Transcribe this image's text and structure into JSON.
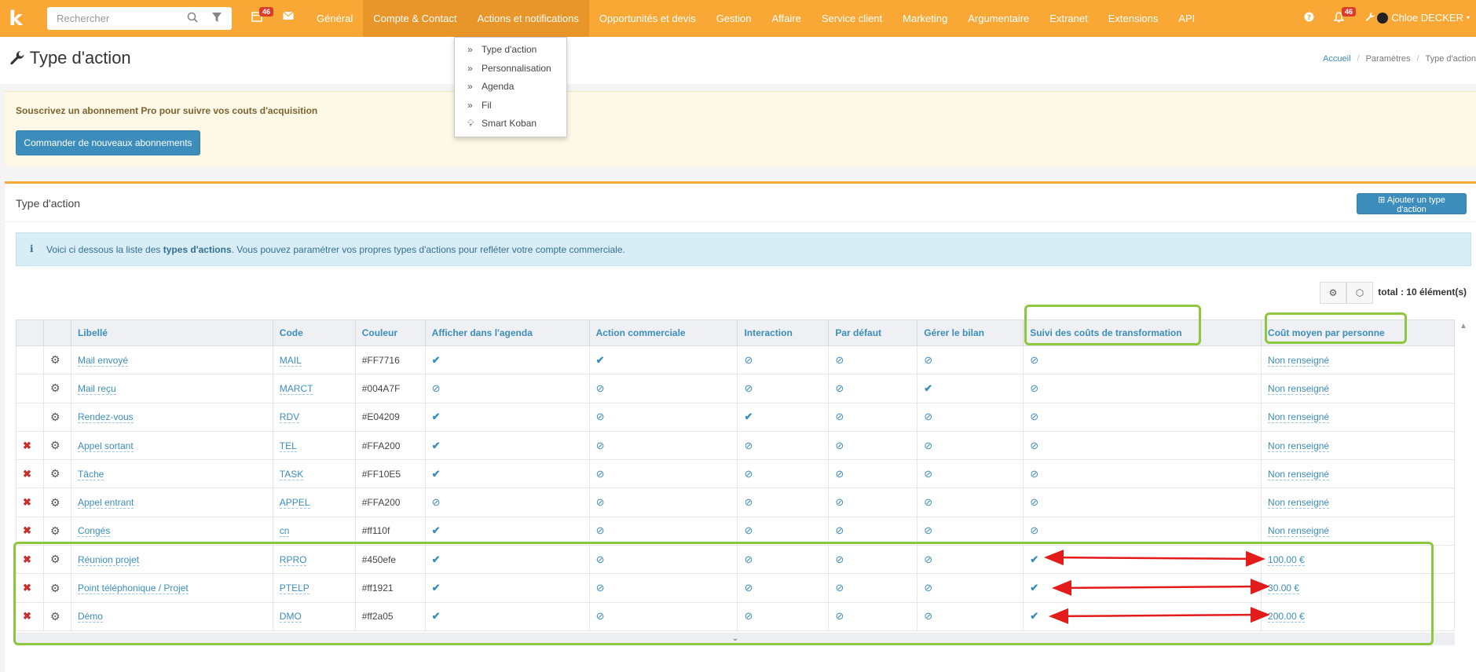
{
  "topbar": {
    "logo": "k",
    "search_placeholder": "Rechercher",
    "calendar_badge": "46",
    "notif_badge": "46",
    "nav": [
      "Général",
      "Compte & Contact",
      "Actions et notifications",
      "Opportunités et devis",
      "Gestion",
      "Affaire",
      "Service client",
      "Marketing",
      "Argumentaire",
      "Extranet",
      "Extensions",
      "API"
    ],
    "user": "Chloe DECKER"
  },
  "dropdown": [
    {
      "icon": "double-chevron-icon",
      "label": "Type d'action"
    },
    {
      "icon": "double-chevron-icon",
      "label": "Personnalisation"
    },
    {
      "icon": "double-chevron-icon",
      "label": "Agenda"
    },
    {
      "icon": "double-chevron-icon",
      "label": "Fil"
    },
    {
      "icon": "lightbulb-icon",
      "label": "Smart Koban"
    }
  ],
  "page": {
    "title": "Type d'action",
    "breadcrumb": [
      "Accueil",
      "Paramètres",
      "Type d'action"
    ]
  },
  "alert": {
    "text": "Souscrivez un abonnement Pro pour suivre vos couts d'acquisition",
    "button": "Commander de nouveaux abonnements"
  },
  "box": {
    "title": "Type d'action",
    "add_button": "Ajouter un type d'action",
    "info_pre": "Voici ci dessous la liste des ",
    "info_bold": "types d'actions",
    "info_post": ". Vous pouvez paramétrer vos propres types d'actions pour refléter votre compte commerciale.",
    "total": "total : 10 élément(s)"
  },
  "table": {
    "headers": [
      "Libellé",
      "Code",
      "Couleur",
      "Afficher dans l'agenda",
      "Action commerciale",
      "Interaction",
      "Par défaut",
      "Gérer le bilan",
      "Suivi des coûts de transformation",
      "Coût moyen par personne"
    ],
    "rows": [
      {
        "del": false,
        "label": "Mail envoyé",
        "code": "MAIL",
        "color": "#FF7716",
        "agenda": true,
        "commercial": true,
        "interaction": false,
        "default": false,
        "bilan": false,
        "suivi": false,
        "cout": "Non renseigné"
      },
      {
        "del": false,
        "label": "Mail reçu",
        "code": "MARCT",
        "color": "#004A7F",
        "agenda": false,
        "commercial": false,
        "interaction": false,
        "default": false,
        "bilan": true,
        "suivi": false,
        "cout": "Non renseigné"
      },
      {
        "del": false,
        "label": "Rendez-vous",
        "code": "RDV",
        "color": "#E04209",
        "agenda": true,
        "commercial": false,
        "interaction": true,
        "default": false,
        "bilan": false,
        "suivi": false,
        "cout": "Non renseigné"
      },
      {
        "del": true,
        "label": "Appel sortant",
        "code": "TEL",
        "color": "#FFA200",
        "agenda": true,
        "commercial": false,
        "interaction": false,
        "default": false,
        "bilan": false,
        "suivi": false,
        "cout": "Non renseigné"
      },
      {
        "del": true,
        "label": "Tâche",
        "code": "TASK",
        "color": "#FF10E5",
        "agenda": true,
        "commercial": false,
        "interaction": false,
        "default": false,
        "bilan": false,
        "suivi": false,
        "cout": "Non renseigné"
      },
      {
        "del": true,
        "label": "Appel entrant",
        "code": "APPEL",
        "color": "#FFA200",
        "agenda": false,
        "commercial": false,
        "interaction": false,
        "default": false,
        "bilan": false,
        "suivi": false,
        "cout": "Non renseigné"
      },
      {
        "del": true,
        "label": "Congés",
        "code": "cn",
        "color": "#ff110f",
        "agenda": true,
        "commercial": false,
        "interaction": false,
        "default": false,
        "bilan": false,
        "suivi": false,
        "cout": "Non renseigné"
      },
      {
        "del": true,
        "label": "Réunion projet",
        "code": "RPRO",
        "color": "#450efe",
        "agenda": true,
        "commercial": false,
        "interaction": false,
        "default": false,
        "bilan": false,
        "suivi": true,
        "cout": "100.00 €"
      },
      {
        "del": true,
        "label": "Point téléphonique / Projet",
        "code": "PTELP",
        "color": "#ff1921",
        "agenda": true,
        "commercial": false,
        "interaction": false,
        "default": false,
        "bilan": false,
        "suivi": true,
        "cout": "30.00 €"
      },
      {
        "del": true,
        "label": "Démo",
        "code": "DMO",
        "color": "#ff2a05",
        "agenda": true,
        "commercial": false,
        "interaction": false,
        "default": false,
        "bilan": false,
        "suivi": true,
        "cout": "200.00 €"
      }
    ]
  },
  "colors": {
    "accent": "#f9a836",
    "link": "#3c8dbc",
    "highlight": "#8dc63f",
    "arrow": "#e31b1b",
    "delete": "#c9302c"
  }
}
